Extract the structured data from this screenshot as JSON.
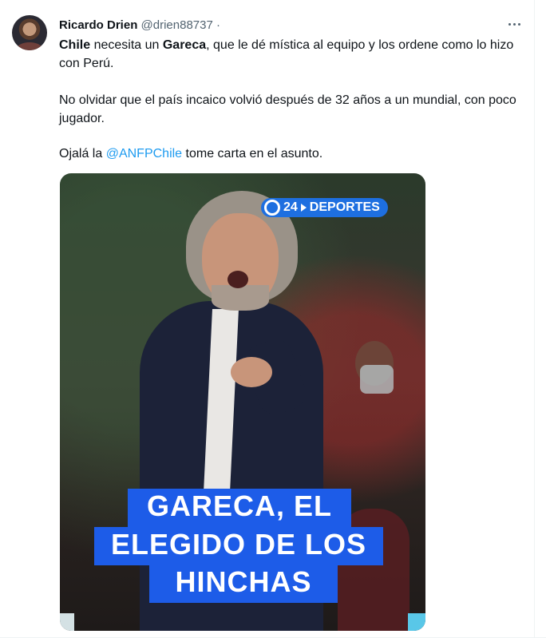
{
  "tweet": {
    "author_name": "Ricardo Drien",
    "author_handle": "@drien88737",
    "separator": "·",
    "p1": {
      "b1": "Chile",
      "s1": " necesita un ",
      "b2": "Gareca",
      "s2": ", que le dé mística al equipo y los ordene como lo hizo con Perú."
    },
    "p2": "No olvidar que el país incaico volvió después de 32 años a un mundial, con poco jugador.",
    "p3": {
      "s1": "Ojalá la ",
      "mention": "@ANFPChile",
      "s2": " tome carta en el asunto."
    }
  },
  "media": {
    "logo_text": "24",
    "logo_brand": "DEPORTES",
    "caption_lines": [
      "GARECA, EL",
      "ELEGIDO DE LOS",
      "HINCHAS"
    ]
  },
  "colors": {
    "mention": "#1d9bf0",
    "caption_bg": "#1d5ce8",
    "logo_bg": "#1e6fe0"
  },
  "icons": {
    "more": "more-horizontal-icon"
  }
}
